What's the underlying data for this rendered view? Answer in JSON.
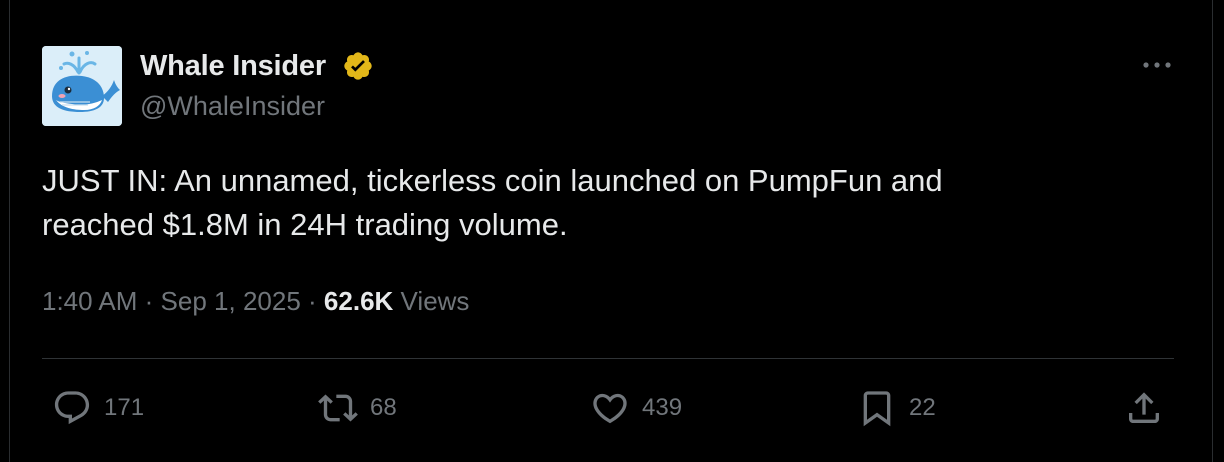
{
  "tweet": {
    "author": {
      "name": "Whale Insider",
      "handle": "@WhaleInsider",
      "avatar": "whale-avatar",
      "verified": true,
      "verified_color": "#e2b719"
    },
    "text": "JUST IN: An unnamed, tickerless coin launched on PumpFun and\nreached $1.8M in 24H trading volume.",
    "time": "1:40 AM",
    "date": "Sep 1, 2025",
    "separator": "·",
    "views_count": "62.6K",
    "views_label": "Views",
    "actions": {
      "replies": {
        "icon": "reply-icon",
        "count": "171"
      },
      "reposts": {
        "icon": "repost-icon",
        "count": "68"
      },
      "likes": {
        "icon": "heart-icon",
        "count": "439"
      },
      "bookmarks": {
        "icon": "bookmark-icon",
        "count": "22"
      },
      "share": {
        "icon": "share-icon"
      }
    },
    "more_icon": "more-icon"
  },
  "colors": {
    "background": "#000000",
    "text": "#e7e9ea",
    "secondary": "#71767b",
    "divider": "#2f3336"
  }
}
